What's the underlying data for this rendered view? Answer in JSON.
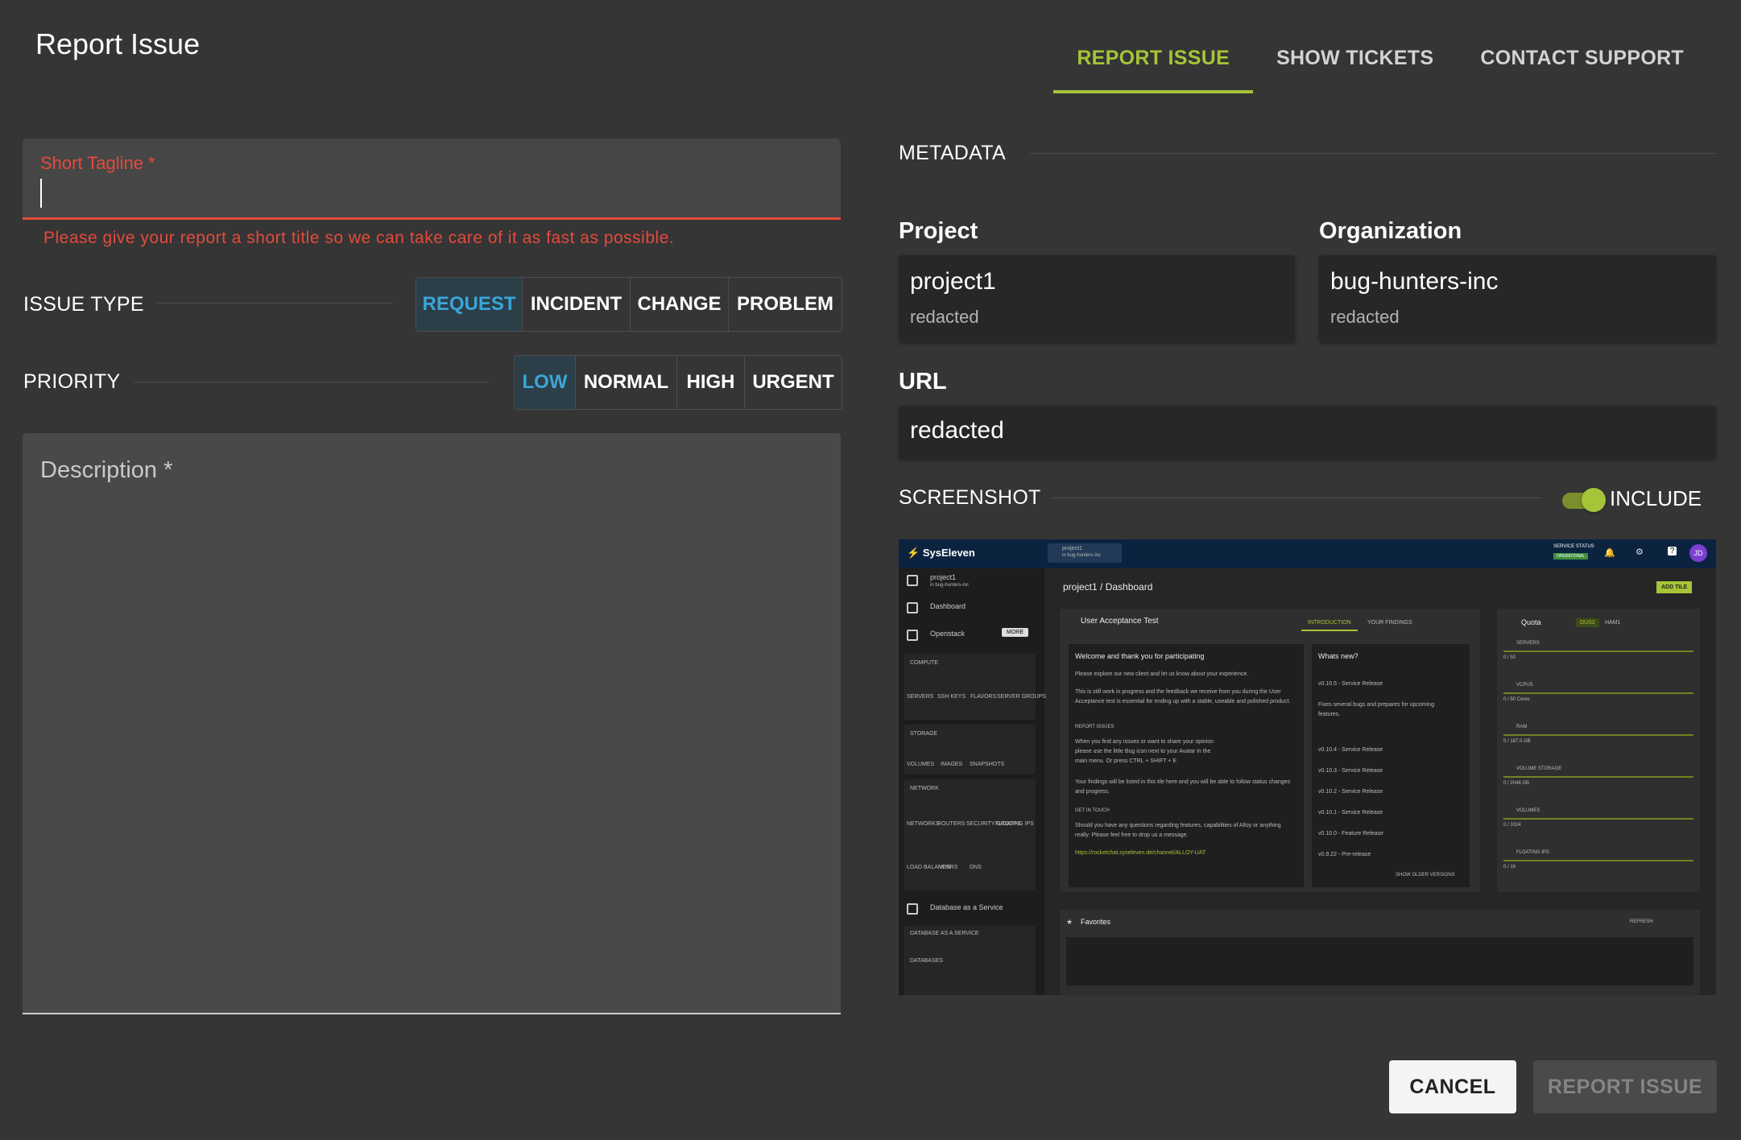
{
  "dialog": {
    "title": "Report Issue"
  },
  "tabs": [
    {
      "label": "REPORT ISSUE",
      "active": true
    },
    {
      "label": "SHOW TICKETS",
      "active": false
    },
    {
      "label": "CONTACT SUPPORT",
      "active": false
    }
  ],
  "form": {
    "tagline": {
      "label": "Short Tagline *",
      "value": "",
      "error": "Please give your report a short title so we can take care of it as fast as possible."
    },
    "issue_type": {
      "label": "ISSUE TYPE",
      "options": [
        "REQUEST",
        "INCIDENT",
        "CHANGE",
        "PROBLEM"
      ],
      "selected": "REQUEST"
    },
    "priority": {
      "label": "PRIORITY",
      "options": [
        "LOW",
        "NORMAL",
        "HIGH",
        "URGENT"
      ],
      "selected": "LOW"
    },
    "description": {
      "label": "Description *"
    }
  },
  "metadata": {
    "label": "METADATA",
    "project": {
      "heading": "Project",
      "value": "project1",
      "sub": "redacted"
    },
    "organization": {
      "heading": "Organization",
      "value": "bug-hunters-inc",
      "sub": "redacted"
    },
    "url": {
      "heading": "URL",
      "value": "redacted"
    }
  },
  "screenshot": {
    "label": "SCREENSHOT",
    "include_label": "INCLUDE",
    "include": true,
    "preview": {
      "brand": "SysEleven",
      "project": "project1",
      "project_sub": "in bug-hunters-inc",
      "service_status": "SERVICE STATUS",
      "service_status_badge": "OPERATIONAL",
      "avatar": "JD",
      "sidebar": {
        "dashboard": "Dashboard",
        "openstack": "Openstack",
        "more": "MORE",
        "compute_label": "COMPUTE",
        "compute": [
          "SERVERS",
          "SSH KEYS",
          "FLAVORS",
          "SERVER GROUPS"
        ],
        "storage_label": "STORAGE",
        "storage": [
          "VOLUMES",
          "IMAGES",
          "SNAPSHOTS"
        ],
        "network_label": "NETWORK",
        "network": [
          "NETWORKS",
          "ROUTERS",
          "SECURITY GROUPS",
          "FLOATING IPS",
          "LOAD BALANCERS",
          "VPN",
          "DNS"
        ],
        "dbaas": "Database as a Service",
        "dbaas_label": "DATABASE AS A SERVICE",
        "dbaas_items": [
          "DATABASES"
        ]
      },
      "breadcrumb": "project1 / Dashboard",
      "add_tile": "ADD TILE",
      "uat": {
        "title": "User Acceptance Test",
        "tab_intro": "INTRODUCTION",
        "tab_findings": "YOUR FINDINGS",
        "welcome": "Welcome and thank you for participating",
        "p1": "Please explore our new client and let us know about your experience.",
        "p2": "This is still work in progress and the feedback we receive from you during the User Acceptance test is essential for ending up with a stable, useable and polished product.",
        "report_label": "REPORT ISSUES",
        "p3": "When you find any issues or want to share your opinion please use the little Bug icon next to your Avatar in the main menu. Or press CTRL + SHIFT + E",
        "p4": "Your findings will be listed in this tile here and you will be able to follow status changes and progress.",
        "touch_label": "GET IN TOUCH",
        "p5": "Should you have any questions regarding features, capabilities of Alloy or anything really: Please feel free to drop us a message.",
        "link": "https://rocketchat.syseleven.de/channel/ALLOY-UAT"
      },
      "whats_new": {
        "title": "Whats new?",
        "first": "v0.10.5 - Service Release",
        "first_desc": "Fixes several bugs and prepares for upcoming features.",
        "items": [
          "v0.10.4 - Service Release",
          "v0.10.3 - Service Release",
          "v0.10.2 - Service Release",
          "v0.10.1 - Service Release",
          "v0.10.0 - Feature Release",
          "v0.9.22 - Pre-release"
        ],
        "older": "SHOW OLDER VERSIONS"
      },
      "quota": {
        "title": "Quota",
        "regions": [
          "DUS2",
          "HAM1"
        ],
        "rows": [
          {
            "label": "SERVERS",
            "value": "0 / 50"
          },
          {
            "label": "VCPUS",
            "value": "0 / 50 Cores"
          },
          {
            "label": "RAM",
            "value": "0 / 187.5 GB"
          },
          {
            "label": "VOLUME STORAGE",
            "value": "0 / 2048 GB"
          },
          {
            "label": "VOLUMES",
            "value": "0 / 1024"
          },
          {
            "label": "FLOATING IPS",
            "value": "0 / 16"
          }
        ]
      },
      "favorites": {
        "title": "Favorites",
        "refresh": "REFRESH"
      }
    }
  },
  "footer": {
    "cancel": "CANCEL",
    "report": "REPORT ISSUE"
  },
  "colors": {
    "accent": "#a6c437",
    "error": "#e64a3c",
    "selected": "#3aa6d8"
  }
}
